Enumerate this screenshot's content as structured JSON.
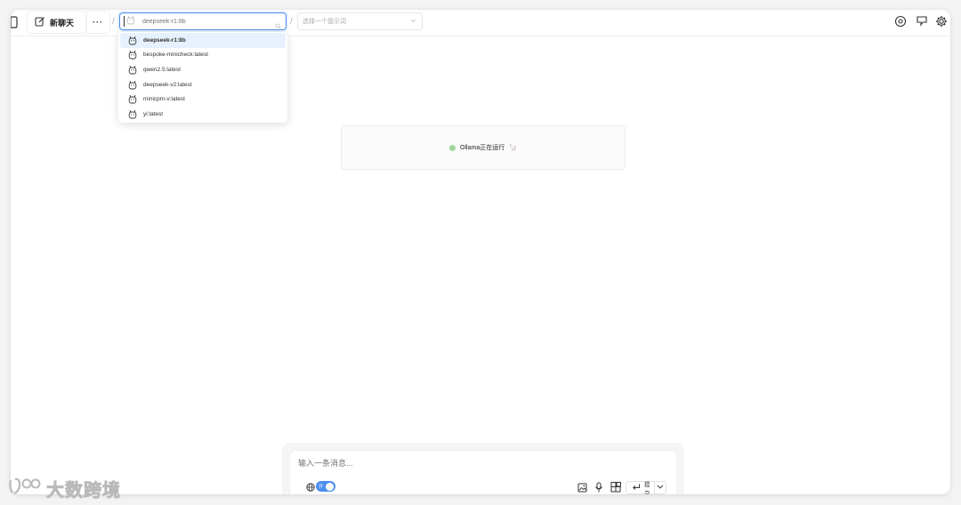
{
  "header": {
    "new_chat_label": "新聊天",
    "more_label": "···",
    "separator": "/",
    "model_search_placeholder": "deepseek-r1:8b",
    "prompt_placeholder": "选择一个提示词"
  },
  "model_dropdown": {
    "items": [
      {
        "label": "deepseek-r1:8b",
        "selected": true
      },
      {
        "label": "bespoke-minicheck:latest",
        "selected": false
      },
      {
        "label": "qwen2.5:latest",
        "selected": false
      },
      {
        "label": "deepseek-v2:latest",
        "selected": false
      },
      {
        "label": "minicpm-v:latest",
        "selected": false
      },
      {
        "label": "yi:latest",
        "selected": false
      }
    ]
  },
  "status": {
    "text": "Ollama正在运行",
    "emoji": "🦙",
    "dot_color": "#9fd89a"
  },
  "composer": {
    "placeholder": "输入一条消息...",
    "web_toggle_label": "开",
    "web_toggle_on": true,
    "submit_label": "提交"
  },
  "watermark": {
    "text": "大数跨境"
  },
  "colors": {
    "accent": "#4a8ef0",
    "selected_row": "#e7f1fd"
  }
}
